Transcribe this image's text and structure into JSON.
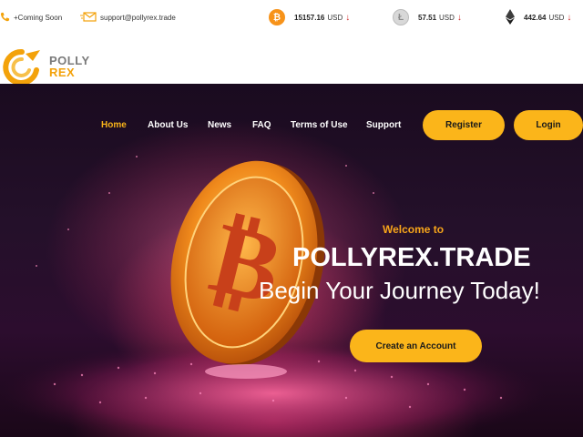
{
  "topbar": {
    "phone_text": "+Coming Soon",
    "email_text": "support@pollyrex.trade",
    "icons": {
      "phone": "phone-icon",
      "email": "envelope-icon"
    },
    "tickers": [
      {
        "coin": "bitcoin",
        "icon": "bitcoin-icon",
        "value": "15157.16",
        "unit": "USD",
        "trend_symbol": "↓"
      },
      {
        "coin": "litecoin",
        "icon": "litecoin-icon",
        "value": "57.51",
        "unit": "USD",
        "trend_symbol": "↓"
      },
      {
        "coin": "ethereum",
        "icon": "ethereum-icon",
        "value": "442.64",
        "unit": "USD",
        "trend_symbol": "↓"
      }
    ]
  },
  "logo": {
    "word1": "POLLY",
    "word2": "REX"
  },
  "nav": {
    "items": [
      {
        "label": "Home",
        "active": true
      },
      {
        "label": "About Us"
      },
      {
        "label": "News"
      },
      {
        "label": "FAQ"
      },
      {
        "label": "Terms of Use"
      },
      {
        "label": "Support"
      }
    ],
    "register_label": "Register",
    "login_label": "Login"
  },
  "hero": {
    "welcome": "Welcome to",
    "brand": "POLLYREX.TRADE",
    "tagline": "Begin Your Journey Today!",
    "cta_label": "Create an Account"
  },
  "colors": {
    "accent": "#fbb51a",
    "nav_active": "#f7b21a",
    "welcome_text": "#f7a51a",
    "trend_down": "#d12a2a",
    "hero_bg": "#24102a"
  }
}
